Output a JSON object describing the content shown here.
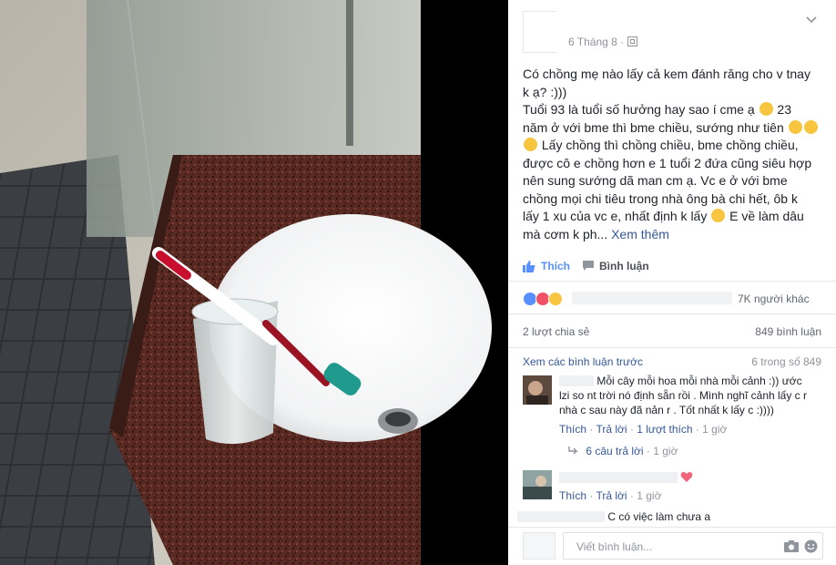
{
  "post": {
    "date": "6 Tháng 8 ·",
    "text_lines": [
      "Có chồng mẹ nào lấy cả kem đánh răng cho v tnay",
      "k ạ? :)))",
      "Tuổi 93 là tuổi số hưởng hay sao í cme ạ",
      "23",
      "năm ở với bme thì bme chiều, sướng như tiên",
      "Lấy chồng thì chồng chiều, bme chồng chiều,",
      "được cô e chồng hơn e 1 tuổi 2 đứa cũng siêu hợp",
      "nên sung sướng dã man cm ạ. Vc e ở với bme",
      "chồng mọi chi tiêu trong nhà ông bà chi hết, ôb k",
      "lấy 1 xu của vc e, nhất định k lấy",
      "E về làm dâu",
      "mà cơm k ph...",
      "Xem thêm"
    ]
  },
  "actions": {
    "like": "Thích",
    "comment": "Bình luận"
  },
  "reactions": {
    "count_text": "7K người khác"
  },
  "stats": {
    "shares": "2 lượt chia sẻ",
    "comments": "849 bình luận"
  },
  "view_previous": {
    "link": "Xem các bình luận trước",
    "count": "6 trong số 849"
  },
  "comments": [
    {
      "text_lines": [
        "Mỗi cây mỗi hoa mỗi nhà mỗi cảnh :)) ước",
        "lzi so nt trời nó định sẵn rồi . Mình nghĩ cảnh lấy c r",
        "nhà c sau này đã nản r . Tốt nhất k lấy c :))))"
      ],
      "like": "Thích",
      "reply": "Trả lời",
      "likes": "1 lượt thích",
      "time": "1 giờ"
    },
    {
      "text": "",
      "like": "Thích",
      "reply": "Trả lời",
      "time": "1 giờ"
    },
    {
      "text": "C có việc làm chưa a"
    }
  ],
  "replies": {
    "text": "6 câu trả lời",
    "time": "1 giờ"
  },
  "input": {
    "placeholder": "Viết bình luận..."
  },
  "colors": {
    "link": "#365899",
    "like_blue": "#5890ff",
    "meta_gray": "#90949c",
    "text": "#1d2129"
  },
  "icons": [
    "chevron-down-icon",
    "globe-icon",
    "like-icon",
    "comment-icon",
    "like-reaction-icon",
    "love-reaction-icon",
    "haha-reaction-icon",
    "reply-arrow-icon",
    "heart-icon",
    "camera-icon",
    "sticker-icon"
  ]
}
